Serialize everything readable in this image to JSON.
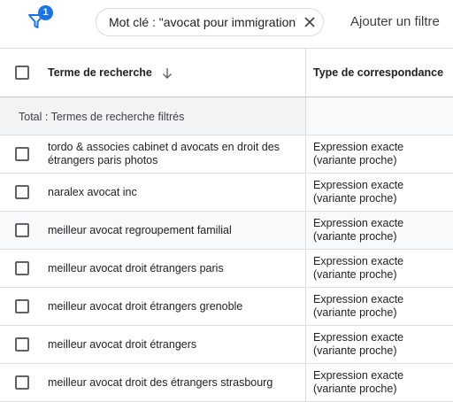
{
  "filter_bar": {
    "filter_count": "1",
    "chip_label": "Mot clé : \"avocat pour immigration\"",
    "add_filter_label": "Ajouter un filtre"
  },
  "table": {
    "headers": {
      "term": "Terme de recherche",
      "match_type": "Type de correspondance"
    },
    "total_label": "Total : Termes de recherche filtrés",
    "rows": [
      {
        "term": "tordo & associes cabinet d avocats en droit des étrangers paris photos",
        "match_type": "Expression exacte (variante proche)"
      },
      {
        "term": "naralex avocat inc",
        "match_type": "Expression exacte (variante proche)"
      },
      {
        "term": "meilleur avocat regroupement familial",
        "match_type": "Expression exacte (variante proche)"
      },
      {
        "term": "meilleur avocat droit étrangers paris",
        "match_type": "Expression exacte (variante proche)"
      },
      {
        "term": "meilleur avocat droit étrangers grenoble",
        "match_type": "Expression exacte (variante proche)"
      },
      {
        "term": "meilleur avocat droit étrangers",
        "match_type": "Expression exacte (variante proche)"
      },
      {
        "term": "meilleur avocat droit des étrangers strasbourg",
        "match_type": "Expression exacte (variante proche)"
      }
    ]
  },
  "colors": {
    "accent": "#1a73e8",
    "hover_row": "#f8f9fa",
    "total_row": "#f1f3f4"
  }
}
